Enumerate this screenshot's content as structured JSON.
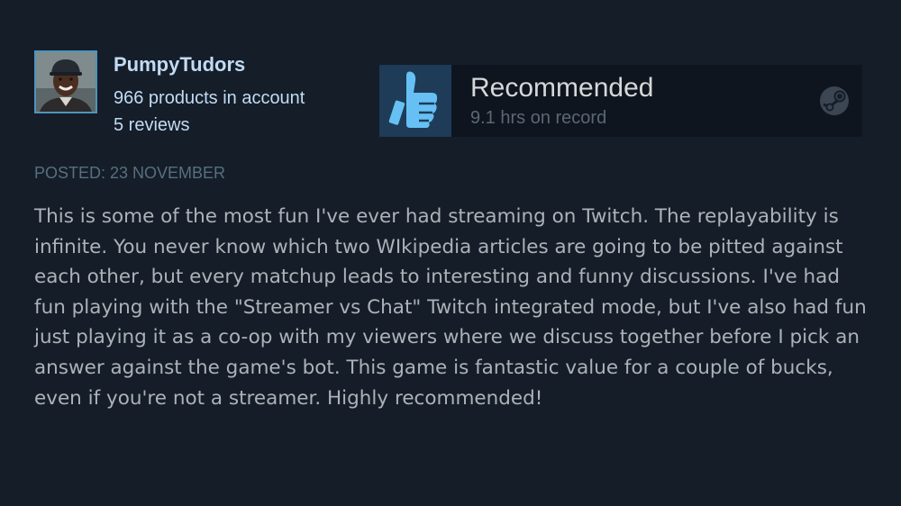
{
  "author": {
    "name": "PumpyTudors",
    "products": "966 products in account",
    "reviews": "5 reviews",
    "avatar_icon": "user-avatar"
  },
  "recommendation": {
    "verdict": "Recommended",
    "hours": "9.1 hrs on record",
    "thumb_icon": "thumbs-up-icon",
    "platform_icon": "steam-icon"
  },
  "review": {
    "posted": "POSTED: 23 NOVEMBER",
    "text": "This is some of the most fun I've ever had streaming on Twitch. The replayability is infinite. You never know which two WIkipedia articles are going to be pitted against each other, but every matchup leads to interesting and funny discussions. I've had fun playing with the \"Streamer vs Chat\" Twitch integrated mode, but I've also had fun just playing it as a co-op with my viewers where we discuss together before I pick an answer against the game's bot. This game is fantastic value for a couple of bucks, even if you're not a streamer. Highly recommended!"
  },
  "colors": {
    "background": "#151d28",
    "author_text": "#c1dbf4",
    "thumb_blue": "#66c0f4",
    "body_text": "#acb2b8"
  }
}
